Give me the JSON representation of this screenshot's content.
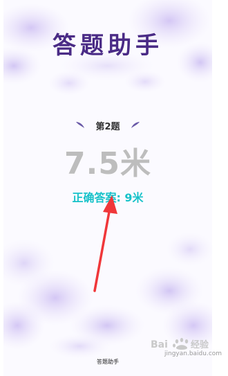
{
  "app": {
    "title": "答题助手",
    "footer_label": "答题助手"
  },
  "question": {
    "label": "第2题",
    "answer_value": "7.5米",
    "correct_answer": "正确答案: 9米"
  },
  "colors": {
    "title": "#4a2b86",
    "answer_value": "#bdbdbd",
    "correct_answer": "#17c2c9",
    "annotation_arrow": "#f0373a",
    "petals": "#c9b8f0"
  },
  "watermark": {
    "text": "Bai经验",
    "url": "jingyan.baidu.com"
  },
  "annotation": {
    "icon": "red-arrow-pointing-up"
  }
}
